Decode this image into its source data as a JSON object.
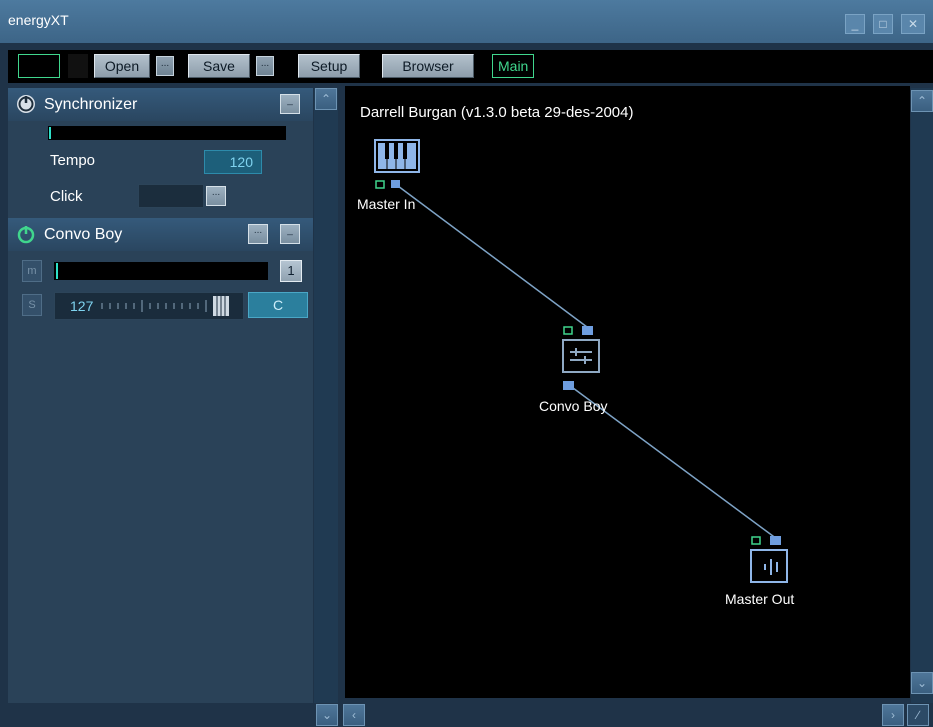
{
  "window": {
    "title": "energyXT",
    "controls": [
      "minimize-icon",
      "restore-icon",
      "close-icon"
    ]
  },
  "toolbar": {
    "open_label": "Open",
    "open_more_label": "...",
    "save_label": "Save",
    "save_more_label": "...",
    "setup_label": "Setup",
    "browser_label": "Browser",
    "main_label": "Main"
  },
  "synchronizer": {
    "title": "Synchronizer",
    "tempo_label": "Tempo",
    "tempo_value": "120",
    "click_label": "Click",
    "click_button_label": "..."
  },
  "convo_boy_panel": {
    "title": "Convo Boy",
    "menu_button_label": "...",
    "channel_value": "1",
    "velocity_value": "127",
    "note_value": "C",
    "m_label": "m",
    "s_label": "S"
  },
  "canvas": {
    "credit": "Darrell Burgan (v1.3.0 beta 29-des-2004)",
    "nodes": [
      {
        "name": "Master In",
        "icon": "keyboard-icon"
      },
      {
        "name": "Convo Boy",
        "icon": "mixer-icon"
      },
      {
        "name": "Master Out",
        "icon": "speaker-output-icon"
      }
    ]
  },
  "colors": {
    "accent_green": "#40d68d",
    "link_line": "#7ea3c6",
    "port_blue": "#6f9ee0",
    "background_panel": "#2a4258"
  }
}
